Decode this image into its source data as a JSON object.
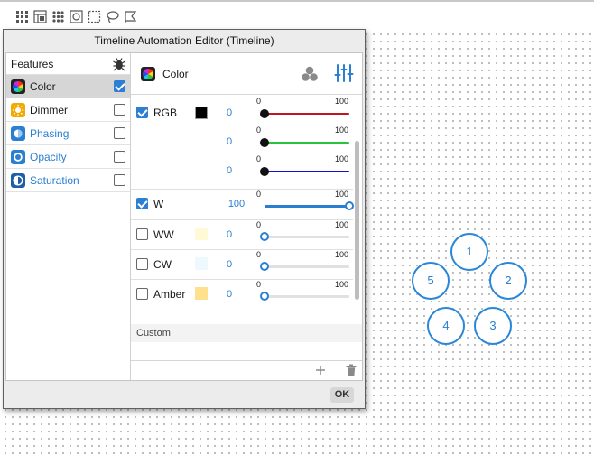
{
  "toolbar": {
    "icons": [
      "grid-icon",
      "layout-icon",
      "group-grid-icon",
      "transform-icon",
      "select-rect-icon",
      "lasso-icon",
      "flag-icon"
    ]
  },
  "dialog": {
    "title": "Timeline Automation Editor (Timeline)",
    "ok_label": "OK"
  },
  "features": {
    "title": "Features",
    "items": [
      {
        "label": "Color",
        "checked": true,
        "selected": true,
        "icon": "color-wheel-icon"
      },
      {
        "label": "Dimmer",
        "checked": false,
        "selected": false,
        "icon": "sun-icon"
      },
      {
        "label": "Phasing",
        "checked": false,
        "selected": false,
        "icon": "phasing-icon"
      },
      {
        "label": "Opacity",
        "checked": false,
        "selected": false,
        "icon": "opacity-icon"
      },
      {
        "label": "Saturation",
        "checked": false,
        "selected": false,
        "icon": "saturation-icon"
      }
    ]
  },
  "pane": {
    "title": "Color",
    "custom_label": "Custom"
  },
  "channels": {
    "rgb": {
      "name": "RGB",
      "checked": true,
      "swatch": "#000000",
      "rows": [
        {
          "value": "0",
          "min": "0",
          "max": "100",
          "level": 0
        },
        {
          "value": "0",
          "min": "0",
          "max": "100",
          "level": 0
        },
        {
          "value": "0",
          "min": "0",
          "max": "100",
          "level": 0
        }
      ]
    },
    "w": {
      "name": "W",
      "checked": true,
      "value": "100",
      "min": "0",
      "max": "100",
      "level": 1
    },
    "ww": {
      "name": "WW",
      "checked": false,
      "value": "0",
      "min": "0",
      "max": "100",
      "level": 0,
      "swatch": "#fff9d6"
    },
    "cw": {
      "name": "CW",
      "checked": false,
      "value": "0",
      "min": "0",
      "max": "100",
      "level": 0,
      "swatch": "#eef9ff"
    },
    "amber": {
      "name": "Amber",
      "checked": false,
      "value": "0",
      "min": "0",
      "max": "100",
      "level": 0,
      "swatch": "#ffe08c"
    }
  },
  "fixtures": [
    "1",
    "2",
    "3",
    "4",
    "5"
  ],
  "colors": {
    "accent": "#2a7fd0",
    "red_track": "#c0141e",
    "green_track": "#28c23c",
    "blue_track": "#1010c8"
  }
}
